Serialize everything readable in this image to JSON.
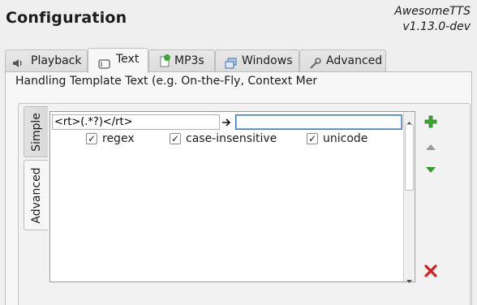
{
  "header": {
    "title": "Configuration",
    "app_name": "AwesomeTTS",
    "version": "v1.13.0-dev"
  },
  "tabs": [
    {
      "label": "Playback",
      "icon": "speaker-icon",
      "active": false
    },
    {
      "label": "Text",
      "icon": "text-box-icon",
      "active": true
    },
    {
      "label": "MP3s",
      "icon": "mp3-file-icon",
      "active": false
    },
    {
      "label": "Windows",
      "icon": "windows-stack-icon",
      "active": false
    },
    {
      "label": "Advanced",
      "icon": "wrench-icon",
      "active": false
    }
  ],
  "section": {
    "hint": "Handling Template Text (e.g. On-the-Fly, Context Menus)"
  },
  "mode_tabs": [
    {
      "label": "Simple",
      "active": false
    },
    {
      "label": "Advanced",
      "active": true
    }
  ],
  "rule": {
    "input_value": "<rt>(.*?)</rt>",
    "replacement_value": "",
    "arrow_icon": "arrow-right-icon",
    "options": [
      {
        "label": "regex",
        "checked": true
      },
      {
        "label": "case-insensitive",
        "checked": true
      },
      {
        "label": "unicode",
        "checked": true
      }
    ]
  },
  "actions": {
    "add": "green-plus-icon",
    "move_up": "triangle-up-icon",
    "move_down": "triangle-down-icon",
    "delete": "red-x-icon"
  },
  "colors": {
    "accent_focus": "#3a7bc4",
    "add_green": "#3aa832",
    "delete_red": "#d32020",
    "move_down_green": "#2e9a28",
    "move_up_gray": "#9a9a9a"
  }
}
